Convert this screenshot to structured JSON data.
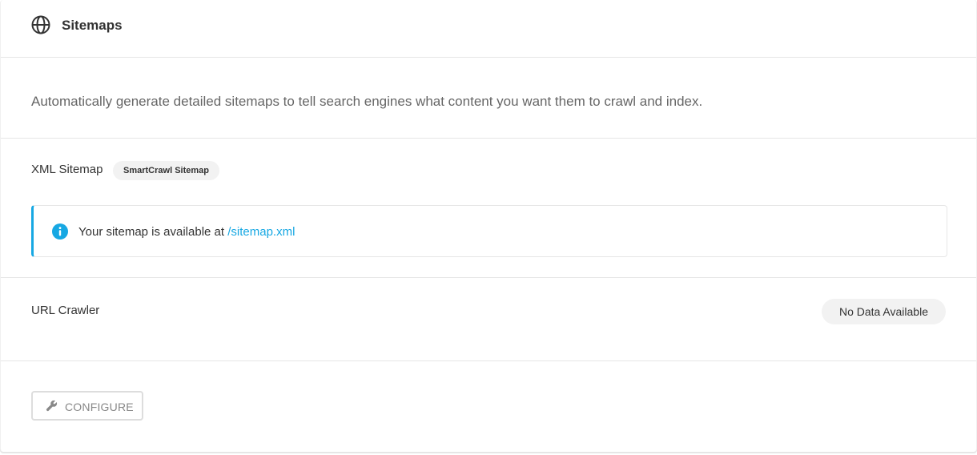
{
  "header": {
    "title": "Sitemaps",
    "icon": "globe-icon"
  },
  "description": "Automatically generate detailed sitemaps to tell search engines what content you want them to crawl and index.",
  "xml_sitemap": {
    "label": "XML Sitemap",
    "tag": "SmartCrawl Sitemap",
    "notice": {
      "icon": "info-icon",
      "text": "Your sitemap is available at",
      "link_text": "/sitemap.xml"
    }
  },
  "url_crawler": {
    "label": "URL Crawler",
    "status": "No Data Available"
  },
  "footer": {
    "configure_label": "CONFIGURE",
    "configure_icon": "wrench-icon"
  },
  "colors": {
    "accent": "#17a8e3",
    "text": "#333333",
    "muted": "#666666",
    "border": "#e6e6e6",
    "pill_bg": "#f2f2f2"
  }
}
